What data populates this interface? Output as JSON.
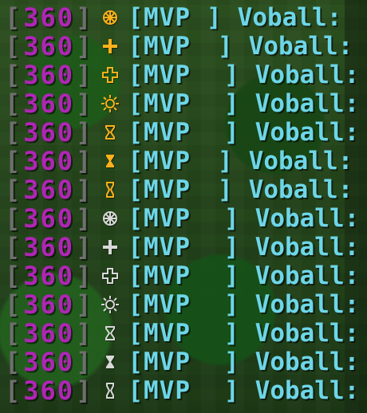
{
  "chat": {
    "lines": [
      {
        "level": "360",
        "badge": "wheel-badge-orange",
        "badge_color": "#ffb11b",
        "tag": "[MVP",
        "tag_end": "]",
        "name": "Voball",
        "suffix": ":"
      },
      {
        "level": "360",
        "badge": "cross-badge-orange",
        "badge_color": "#ffb11b",
        "tag": "[MVP",
        "tag_end": "]",
        "name": "Voball",
        "suffix": ":"
      },
      {
        "level": "360",
        "badge": "outline-cross-badge-orange",
        "badge_color": "#ffb11b",
        "tag": "[MVP",
        "tag_end": "]",
        "name": "Voball",
        "suffix": ":"
      },
      {
        "level": "360",
        "badge": "sun-badge-orange",
        "badge_color": "#ffb11b",
        "tag": "[MVP",
        "tag_end": "]",
        "name": "Voball",
        "suffix": ":"
      },
      {
        "level": "360",
        "badge": "hourglass-badge-orange",
        "badge_color": "#ffb11b",
        "tag": "[MVP",
        "tag_end": "]",
        "name": "Voball",
        "suffix": ":"
      },
      {
        "level": "360",
        "badge": "hourglass-badge-orange",
        "badge_color": "#ffb11b",
        "tag": "[MVP",
        "tag_end": "]",
        "name": "Voball",
        "suffix": ":"
      },
      {
        "level": "360",
        "badge": "hourglass-badge-orange",
        "badge_color": "#ffb11b",
        "tag": "[MVP",
        "tag_end": "]",
        "name": "Voball",
        "suffix": ":"
      },
      {
        "level": "360",
        "badge": "wheel-badge-white",
        "badge_color": "#d8d8d8",
        "tag": "[MVP",
        "tag_end": "]",
        "name": "Voball",
        "suffix": ":"
      },
      {
        "level": "360",
        "badge": "cross-badge-white",
        "badge_color": "#d8d8d8",
        "tag": "[MVP",
        "tag_end": "]",
        "name": "Voball",
        "suffix": ":"
      },
      {
        "level": "360",
        "badge": "outline-cross-badge-white",
        "badge_color": "#d8d8d8",
        "tag": "[MVP",
        "tag_end": "]",
        "name": "Voball",
        "suffix": ":"
      },
      {
        "level": "360",
        "badge": "sun-badge-white",
        "badge_color": "#d8d8d8",
        "tag": "[MVP",
        "tag_end": "]",
        "name": "Voball",
        "suffix": ":"
      },
      {
        "level": "360",
        "badge": "hourglass-badge-white",
        "badge_color": "#d8d8d8",
        "tag": "[MVP",
        "tag_end": "]",
        "name": "Voball",
        "suffix": ":"
      },
      {
        "level": "360",
        "badge": "hourglass-badge-white",
        "badge_color": "#d8d8d8",
        "tag": "[MVP",
        "tag_end": "]",
        "name": "Voball",
        "suffix": ":"
      },
      {
        "level": "360",
        "badge": "hourglass-badge-white",
        "badge_color": "#d8d8d8",
        "tag": "[MVP",
        "tag_end": "]",
        "name": "Voball",
        "suffix": ":"
      }
    ]
  },
  "colors": {
    "bracket": "#6f6f6f",
    "level": "#b025b6",
    "name": "#6dd6e8"
  }
}
